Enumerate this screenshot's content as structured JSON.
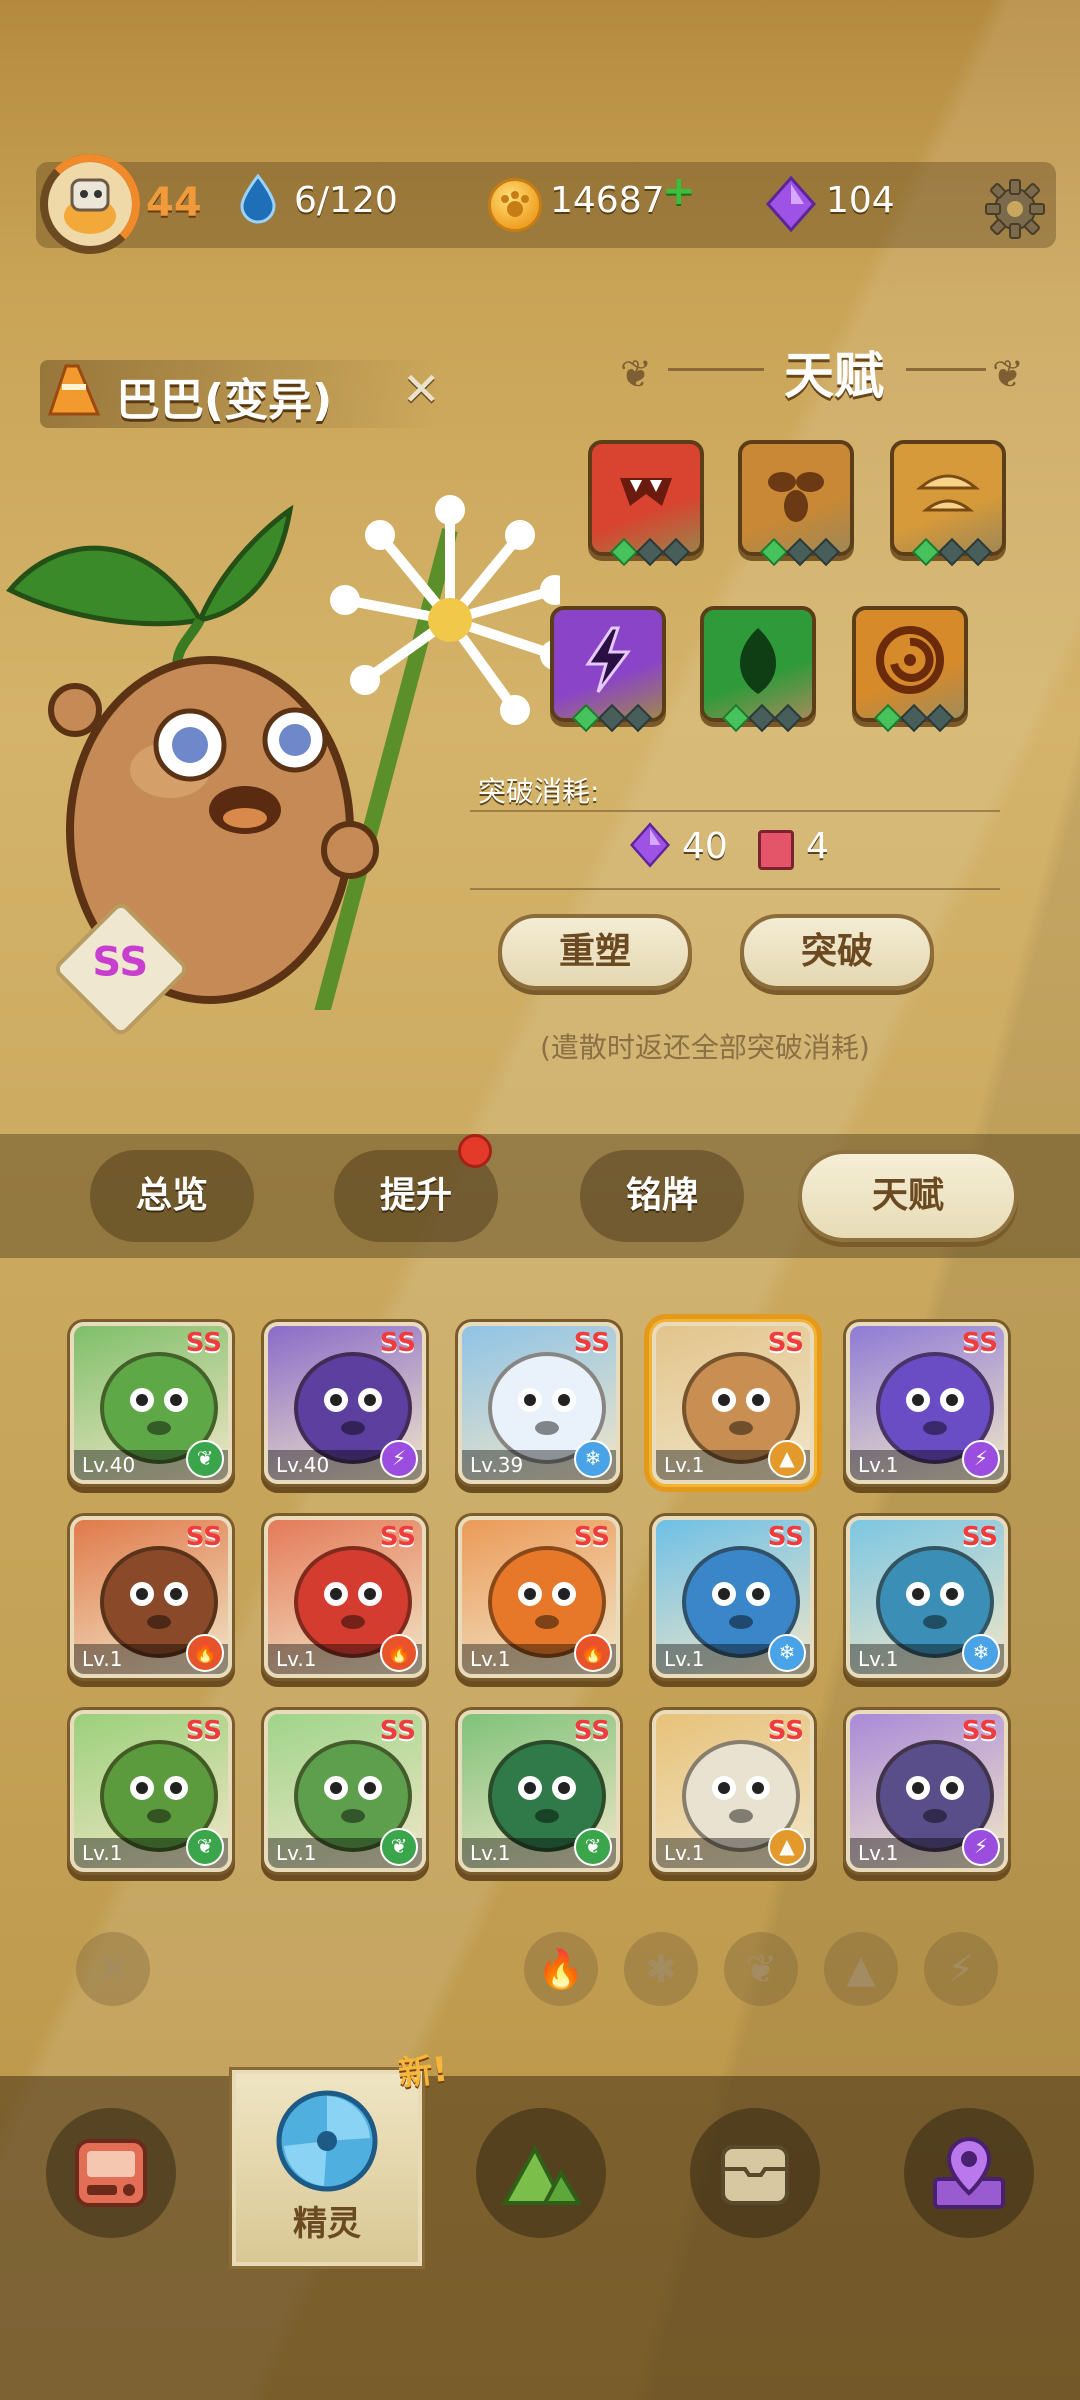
{
  "header": {
    "player_level": "44",
    "stamina": "6/120",
    "coins": "14687",
    "coins_plus": "+",
    "gems": "104"
  },
  "pet": {
    "name": "巴巴(变异)",
    "rarity": "SS"
  },
  "talent": {
    "title": "天赋",
    "skills": [
      {
        "icon": "fang-icon",
        "color": "#d8442f",
        "level": 1
      },
      {
        "icon": "seed-icon",
        "color": "#c98835",
        "level": 1
      },
      {
        "icon": "cloud-icon",
        "color": "#d69a3a",
        "level": 1
      },
      {
        "icon": "lightning-icon",
        "color": "#8a44c8",
        "level": 1
      },
      {
        "icon": "leaf-icon",
        "color": "#2f9a3a",
        "level": 1
      },
      {
        "icon": "swirl-icon",
        "color": "#d68a2a",
        "level": 1
      }
    ],
    "breakthrough_label": "突破消耗:",
    "cost_gems": "40",
    "cost_books": "4",
    "reshape_button": "重塑",
    "breakthrough_button": "突破",
    "note": "(遣散时返还全部突破消耗)"
  },
  "tabs": [
    {
      "label": "总览",
      "active": false
    },
    {
      "label": "提升",
      "active": false,
      "badge": true
    },
    {
      "label": "铭牌",
      "active": false
    },
    {
      "label": "天赋",
      "active": true
    }
  ],
  "pets_grid": [
    {
      "level": "Lv.40",
      "rarity": "SS",
      "bg": "#7fbf6a",
      "face": "#5ea848",
      "element": "leaf"
    },
    {
      "level": "Lv.40",
      "rarity": "SS",
      "bg": "#8b6bc9",
      "face": "#5d3fa0",
      "element": "lightning"
    },
    {
      "level": "Lv.39",
      "rarity": "SS",
      "bg": "#8fc3e6",
      "face": "#e9f2fb",
      "element": "ice"
    },
    {
      "level": "Lv.1",
      "rarity": "SS",
      "bg": "#e2c48c",
      "face": "#c98e52",
      "element": "earth",
      "selected": true
    },
    {
      "level": "Lv.1",
      "rarity": "SS",
      "bg": "#8f7bd6",
      "face": "#6a4cc4",
      "element": "lightning"
    },
    {
      "level": "Lv.1",
      "rarity": "SS",
      "bg": "#e07a4a",
      "face": "#8a4a2a",
      "element": "fire"
    },
    {
      "level": "Lv.1",
      "rarity": "SS",
      "bg": "#e47a58",
      "face": "#d43c30",
      "element": "fire"
    },
    {
      "level": "Lv.1",
      "rarity": "SS",
      "bg": "#eb9a58",
      "face": "#e7782a",
      "element": "fire"
    },
    {
      "level": "Lv.1",
      "rarity": "SS",
      "bg": "#6ec0e6",
      "face": "#3a86c8",
      "element": "ice"
    },
    {
      "level": "Lv.1",
      "rarity": "SS",
      "bg": "#7cc6e2",
      "face": "#3b8fb6",
      "element": "ice"
    },
    {
      "level": "Lv.1",
      "rarity": "SS",
      "bg": "#9bd07a",
      "face": "#5c9a3e",
      "element": "leaf"
    },
    {
      "level": "Lv.1",
      "rarity": "SS",
      "bg": "#9fd48a",
      "face": "#5e9f4e",
      "element": "leaf"
    },
    {
      "level": "Lv.1",
      "rarity": "SS",
      "bg": "#7fc27a",
      "face": "#2f7a48",
      "element": "leaf"
    },
    {
      "level": "Lv.1",
      "rarity": "SS",
      "bg": "#e7c27a",
      "face": "#e9e2d0",
      "element": "earth"
    },
    {
      "level": "Lv.1",
      "rarity": "SS",
      "bg": "#a98ad8",
      "face": "#5a4e8a",
      "element": "lightning"
    }
  ],
  "filters": [
    "fire",
    "ice",
    "leaf",
    "earth",
    "lightning"
  ],
  "nav": {
    "active_label": "精灵",
    "new_tag": "新!"
  },
  "colors": {
    "fire": "#e8542a",
    "ice": "#4aa3e6",
    "leaf": "#3aa54a",
    "earth": "#e39a2a",
    "lightning": "#9b4de0"
  }
}
